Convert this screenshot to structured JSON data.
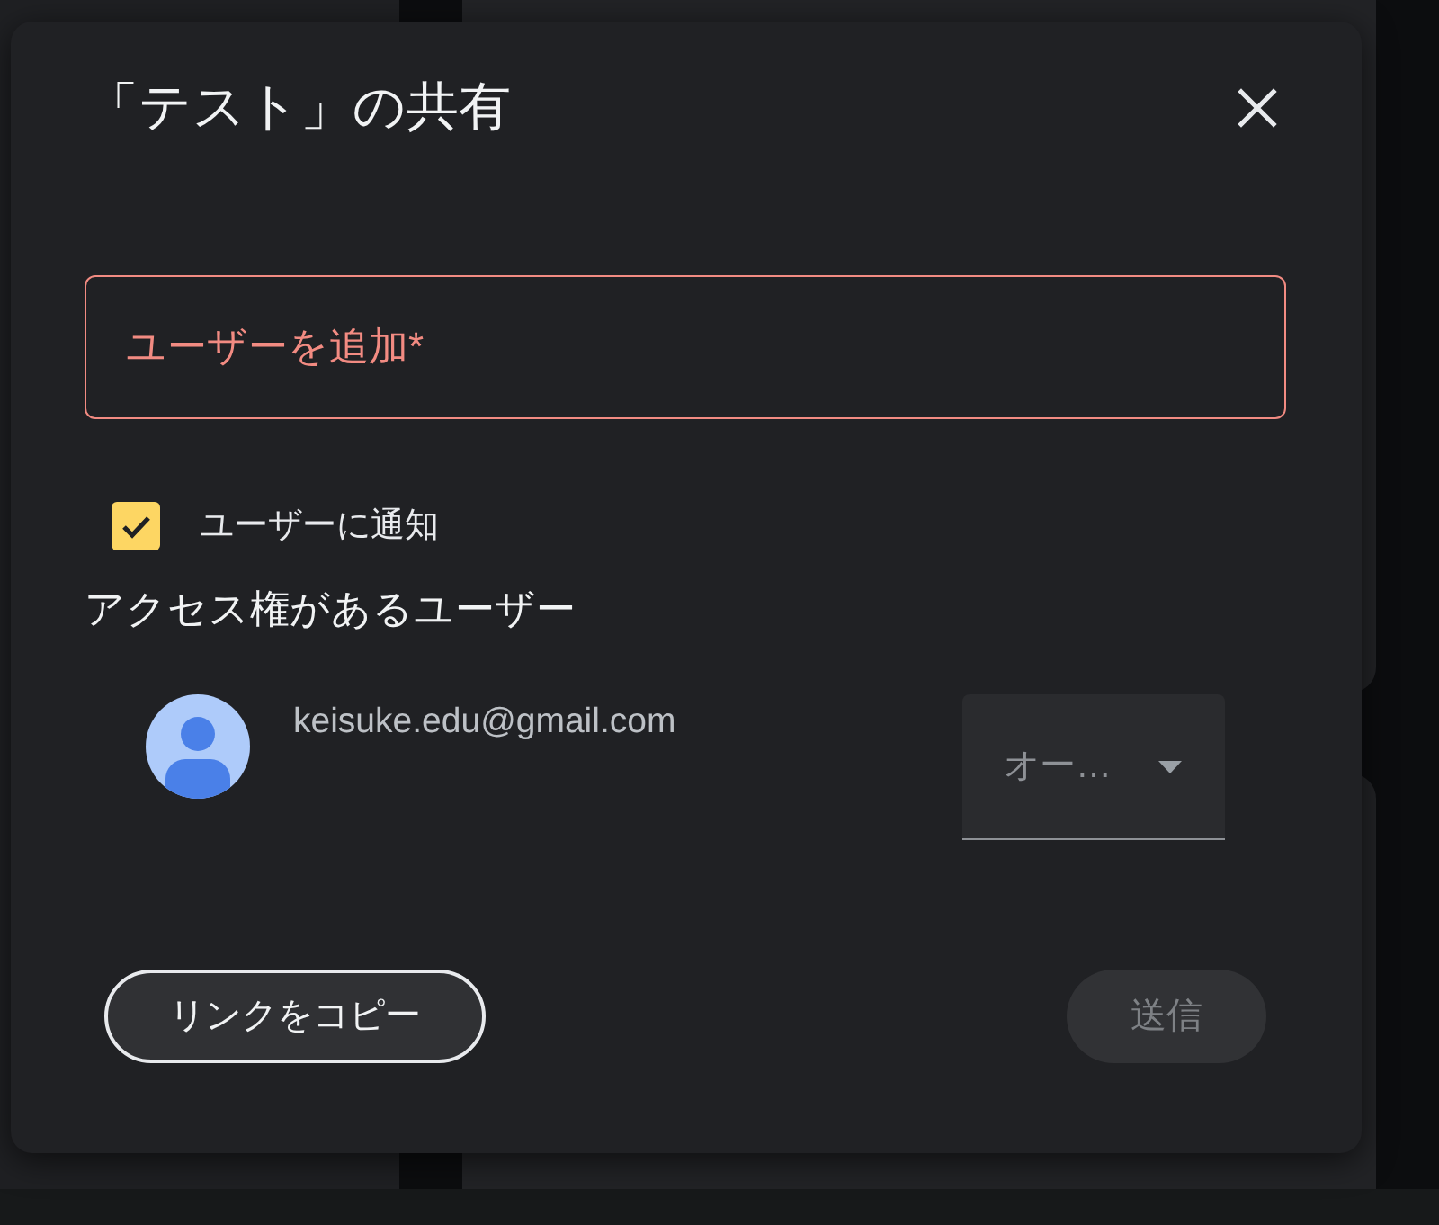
{
  "dialog": {
    "title": "「テスト」の共有"
  },
  "add_user_field": {
    "placeholder": "ユーザーを追加*",
    "invalid": true
  },
  "notify": {
    "label": "ユーザーに通知",
    "checked": true
  },
  "access_heading": "アクセス権があるユーザー",
  "members": [
    {
      "email": "keisuke.edu@gmail.com",
      "role": "オー…"
    }
  ],
  "buttons": [
    {
      "label": "リンクをコピー",
      "kind": "outline",
      "disabled": false
    },
    {
      "label": "送信",
      "kind": "filled",
      "disabled": true
    }
  ]
}
